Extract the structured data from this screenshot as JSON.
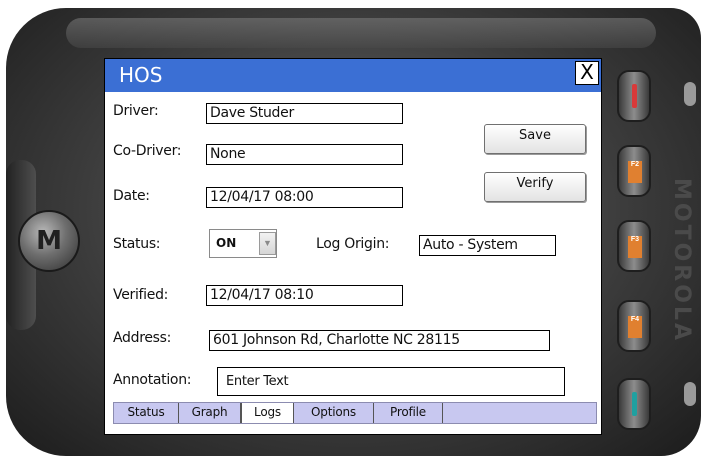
{
  "window": {
    "title": "HOS",
    "close_glyph": "X"
  },
  "form": {
    "driver_label": "Driver:",
    "driver_value": "Dave Studer",
    "codriver_label": "Co-Driver:",
    "codriver_value": "None",
    "date_label": "Date:",
    "date_value": "12/04/17  08:00",
    "status_label": "Status:",
    "status_value": "ON",
    "log_origin_label": "Log Origin:",
    "log_origin_value": "Auto - System",
    "verified_label": "Verified:",
    "verified_value": "12/04/17  08:10",
    "address_label": "Address:",
    "address_value": "601 Johnson Rd, Charlotte NC 28115",
    "annotation_label": "Annotation:",
    "annotation_placeholder": "Enter Text"
  },
  "buttons": {
    "save": "Save",
    "verify": "Verify"
  },
  "tabs": [
    {
      "label": "Status",
      "active": false
    },
    {
      "label": "Graph",
      "active": false
    },
    {
      "label": "Logs",
      "active": true
    },
    {
      "label": "Options",
      "active": false
    },
    {
      "label": "Profile",
      "active": false
    }
  ],
  "device": {
    "side_buttons": [
      {
        "icon": "red-key-icon",
        "color": "#d83a3a",
        "label": ""
      },
      {
        "icon": "softkey-1-icon",
        "color": "#e08030",
        "label": "F2"
      },
      {
        "icon": "softkey-2-icon",
        "color": "#e08030",
        "label": "F3"
      },
      {
        "icon": "softkey-3-icon",
        "color": "#e08030",
        "label": "F4"
      },
      {
        "icon": "green-key-icon",
        "color": "#20a0a0",
        "label": ""
      }
    ]
  },
  "colors": {
    "titlebar": "#3b6fd4",
    "tabbar": "#c8c8f0"
  }
}
